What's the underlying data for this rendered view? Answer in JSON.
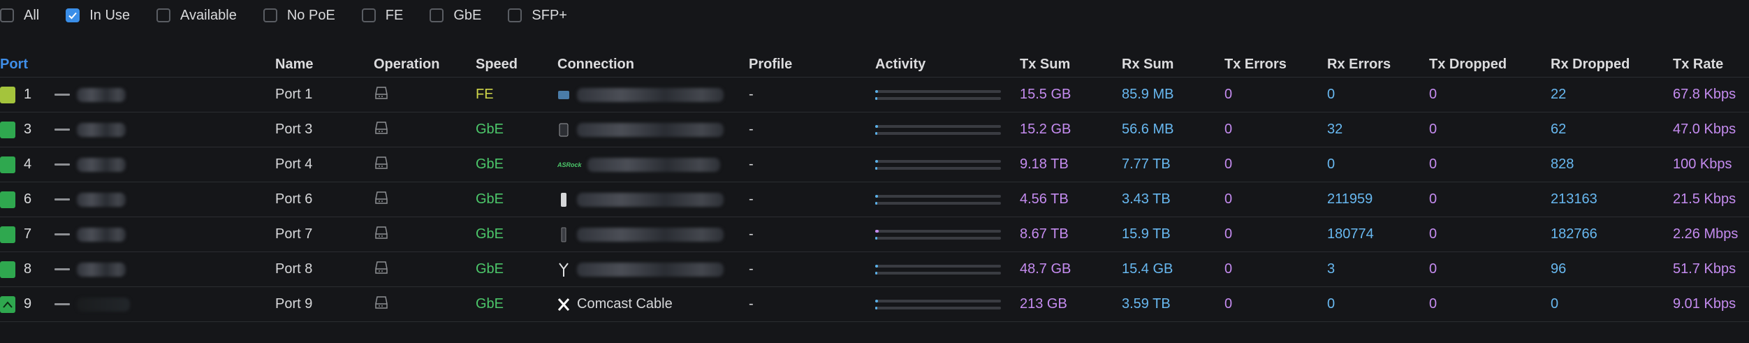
{
  "filters": [
    {
      "label": "All",
      "checked": false
    },
    {
      "label": "In Use",
      "checked": true
    },
    {
      "label": "Available",
      "checked": false
    },
    {
      "label": "No PoE",
      "checked": false
    },
    {
      "label": "FE",
      "checked": false
    },
    {
      "label": "GbE",
      "checked": false
    },
    {
      "label": "SFP+",
      "checked": false
    }
  ],
  "columns": {
    "port": "Port",
    "name": "Name",
    "operation": "Operation",
    "speed": "Speed",
    "connection": "Connection",
    "profile": "Profile",
    "activity": "Activity",
    "tx_sum": "Tx Sum",
    "rx_sum": "Rx Sum",
    "tx_errors": "Tx Errors",
    "rx_errors": "Rx Errors",
    "tx_dropped": "Tx Dropped",
    "rx_dropped": "Rx Dropped",
    "tx_rate": "Tx Rate"
  },
  "rows": [
    {
      "port": "1",
      "name": "Port 1",
      "speed": "FE",
      "connection": "",
      "profile": "-",
      "tx_sum": "15.5 GB",
      "rx_sum": "85.9 MB",
      "tx_errors": "0",
      "rx_errors": "0",
      "tx_dropped": "0",
      "rx_dropped": "22",
      "tx_rate": "67.8 Kbps",
      "activity_tx": 0.02,
      "activity_rx": 0.01
    },
    {
      "port": "3",
      "name": "Port 3",
      "speed": "GbE",
      "connection": "",
      "profile": "-",
      "tx_sum": "15.2 GB",
      "rx_sum": "56.6 MB",
      "tx_errors": "0",
      "rx_errors": "32",
      "tx_dropped": "0",
      "rx_dropped": "62",
      "tx_rate": "47.0 Kbps",
      "activity_tx": 0.02,
      "activity_rx": 0.01
    },
    {
      "port": "4",
      "name": "Port 4",
      "speed": "GbE",
      "connection": "ASRock",
      "profile": "-",
      "tx_sum": "9.18 TB",
      "rx_sum": "7.77 TB",
      "tx_errors": "0",
      "rx_errors": "0",
      "tx_dropped": "0",
      "rx_dropped": "828",
      "tx_rate": "100 Kbps",
      "activity_tx": 0.02,
      "activity_rx": 0.01
    },
    {
      "port": "6",
      "name": "Port 6",
      "speed": "GbE",
      "connection": "",
      "profile": "-",
      "tx_sum": "4.56 TB",
      "rx_sum": "3.43 TB",
      "tx_errors": "0",
      "rx_errors": "211959",
      "tx_dropped": "0",
      "rx_dropped": "213163",
      "tx_rate": "21.5 Kbps",
      "activity_tx": 0.02,
      "activity_rx": 0.01
    },
    {
      "port": "7",
      "name": "Port 7",
      "speed": "GbE",
      "connection": "",
      "profile": "-",
      "tx_sum": "8.67 TB",
      "rx_sum": "15.9 TB",
      "tx_errors": "0",
      "rx_errors": "180774",
      "tx_dropped": "0",
      "rx_dropped": "182766",
      "tx_rate": "2.26 Mbps",
      "activity_tx": 0.03,
      "activity_rx": 0.01
    },
    {
      "port": "8",
      "name": "Port 8",
      "speed": "GbE",
      "connection": "",
      "profile": "-",
      "tx_sum": "48.7 GB",
      "rx_sum": "15.4 GB",
      "tx_errors": "0",
      "rx_errors": "3",
      "tx_dropped": "0",
      "rx_dropped": "96",
      "tx_rate": "51.7 Kbps",
      "activity_tx": 0.02,
      "activity_rx": 0.01
    },
    {
      "port": "9",
      "name": "Port 9",
      "speed": "GbE",
      "connection": "Comcast Cable",
      "profile": "-",
      "tx_sum": "213 GB",
      "rx_sum": "3.59 TB",
      "tx_errors": "0",
      "rx_errors": "0",
      "tx_dropped": "0",
      "rx_dropped": "0",
      "tx_rate": "9.01 Kbps",
      "activity_tx": 0.02,
      "activity_rx": 0.01
    }
  ],
  "colors": {
    "accent": "#3a8ee8",
    "speed_fe": "#cfd64a",
    "speed_gbe": "#4cc76a",
    "tx": "#c58cf0",
    "rx": "#68b8f0",
    "port_up": "#2fa84f",
    "port_fe": "#a4c43c"
  }
}
